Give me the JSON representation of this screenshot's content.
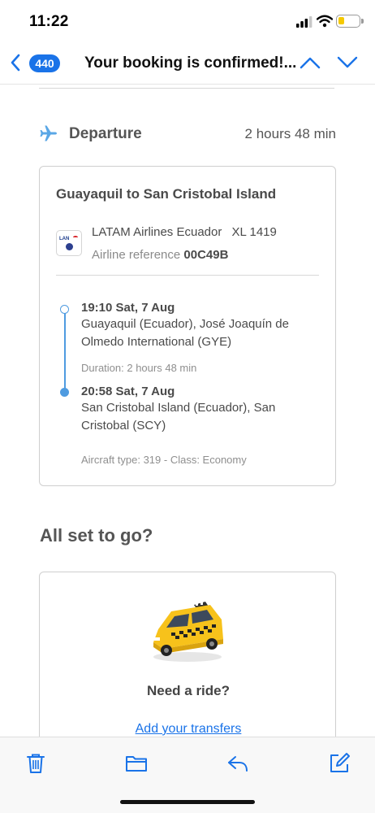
{
  "status_bar": {
    "time": "11:22"
  },
  "nav": {
    "badge_count": "440",
    "title": "Your booking is confirmed!..."
  },
  "departure": {
    "label": "Departure",
    "duration": "2 hours 48 min"
  },
  "flight": {
    "route_title": "Guayaquil to San Cristobal Island",
    "airline_name": "LATAM Airlines Ecuador",
    "flight_number": "XL 1419",
    "airline_ref_label": "Airline reference",
    "airline_ref_value": "00C49B",
    "logo_text": "LAN",
    "departure_time": "19:10 Sat, 7 Aug",
    "departure_place": "Guayaquil (Ecuador), José Joaquín de Olmedo International (GYE)",
    "duration_text": "Duration: 2 hours 48 min",
    "arrival_time": "20:58 Sat, 7 Aug",
    "arrival_place": "San Cristobal Island (Ecuador), San Cristobal (SCY)",
    "aircraft_text": "Aircraft type: 319 - Class: Economy"
  },
  "all_set": {
    "title": "All set to go?",
    "ride_title": "Need a ride?",
    "ride_link": "Add your transfers"
  },
  "colors": {
    "accent_blue": "#1a73e8",
    "timeline_blue": "#4f9be0",
    "taxi_yellow": "#f7c21b"
  },
  "icons": {
    "back": "chevron-left-icon",
    "prev": "chevron-up-icon",
    "next": "chevron-down-icon",
    "plane": "airplane-icon",
    "taxi": "taxi-icon",
    "trash": "trash-icon",
    "folder": "folder-icon",
    "reply": "reply-icon",
    "compose": "compose-icon"
  }
}
